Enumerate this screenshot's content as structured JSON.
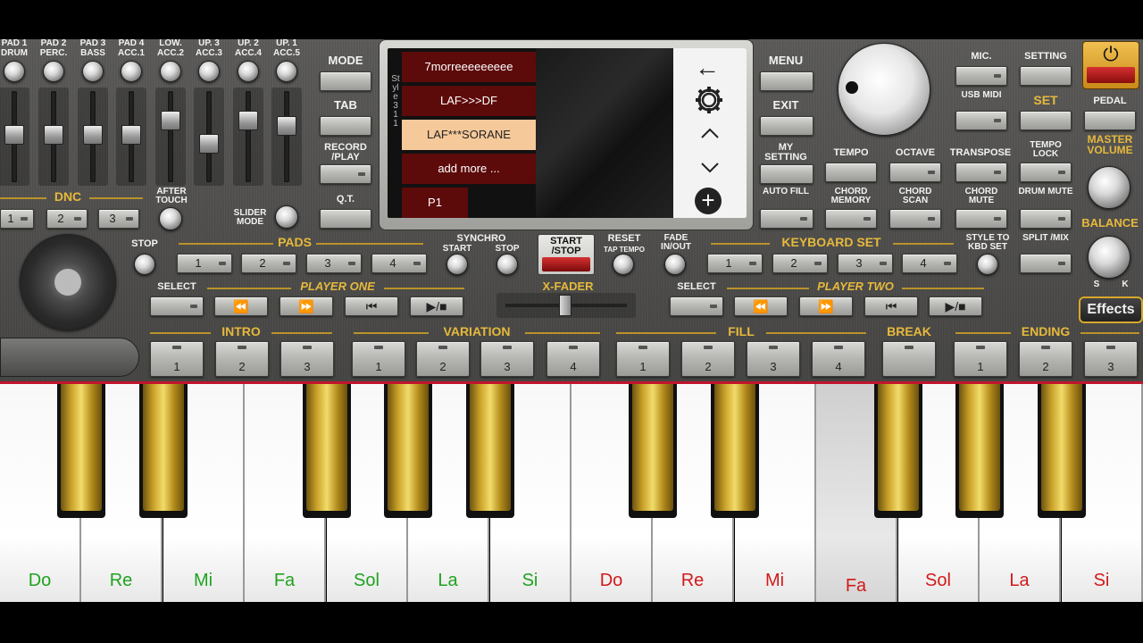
{
  "mixer": {
    "channels": [
      {
        "l1": "PAD 1",
        "l2": "DRUM"
      },
      {
        "l1": "PAD 2",
        "l2": "PERC."
      },
      {
        "l1": "PAD 3",
        "l2": "BASS"
      },
      {
        "l1": "PAD 4",
        "l2": "ACC.1"
      },
      {
        "l1": "LOW.",
        "l2": "ACC.2"
      },
      {
        "l1": "UP. 3",
        "l2": "ACC.3"
      },
      {
        "l1": "UP. 2",
        "l2": "ACC.4"
      },
      {
        "l1": "UP. 1",
        "l2": "ACC.5"
      }
    ],
    "dnc_label": "DNC",
    "dnc_buttons": [
      "1",
      "2",
      "3"
    ],
    "after_touch": "AFTER TOUCH",
    "slider_mode": "SLIDER MODE"
  },
  "left_buttons": {
    "mode": "MODE",
    "tab": "TAB",
    "record_play": "RECORD /PLAY",
    "qt": "Q.T."
  },
  "screen": {
    "side_label": "Style 3 1 1",
    "styles": [
      "7morreeeeeeeee",
      "LAF>>>DF",
      "LAF***SORANE",
      "add more ..."
    ],
    "selected_index": 2,
    "p1": "P1"
  },
  "right_menu": {
    "menu": "MENU",
    "exit": "EXIT",
    "my_setting": "MY SETTING",
    "auto_fill": "AUTO FILL"
  },
  "top_right": {
    "mic": "MIC.",
    "setting": "SETTING",
    "usb_midi": "USB MIDI",
    "set": "SET",
    "pedal": "PEDAL",
    "tempo": "TEMPO",
    "octave": "OCTAVE",
    "transpose": "TRANSPOSE",
    "tempo_lock": "TEMPO LOCK",
    "master_volume": "MASTER VOLUME",
    "chord_memory": "CHORD MEMORY",
    "chord_scan": "CHORD SCAN",
    "chord_mute": "CHORD MUTE",
    "drum_mute": "DRUM MUTE",
    "balance": "BALANCE",
    "balance_s": "S",
    "balance_k": "K",
    "effects": "Effects"
  },
  "pads": {
    "stop": "STOP",
    "label": "PADS",
    "buttons": [
      "1",
      "2",
      "3",
      "4"
    ],
    "synchro": "SYNCHRO",
    "sync_start": "START",
    "sync_stop": "STOP",
    "start_stop": "START /STOP",
    "reset": "RESET",
    "tap_tempo": "TAP TEMPO",
    "fade": "FADE IN/OUT"
  },
  "keyboard_set": {
    "label": "KEYBOARD SET",
    "buttons": [
      "1",
      "2",
      "3",
      "4"
    ],
    "style_to_kbd": "STYLE TO KBD SET",
    "split_mix": "SPLIT /MIX"
  },
  "players": {
    "select": "SELECT",
    "player_one": "PLAYER ONE",
    "x_fader": "X-FADER",
    "player_two": "PLAYER TWO",
    "transport": [
      "⏪",
      "⏩",
      "⏮",
      "▶/■"
    ]
  },
  "arranger": {
    "intro": "INTRO",
    "intro_buttons": [
      "1",
      "2",
      "3"
    ],
    "variation": "VARIATION",
    "variation_buttons": [
      "1",
      "2",
      "3",
      "4"
    ],
    "fill": "FILL",
    "fill_buttons": [
      "1",
      "2",
      "3",
      "4"
    ],
    "break": "BREAK",
    "ending": "ENDING",
    "ending_buttons": [
      "1",
      "2",
      "3"
    ]
  },
  "keys": {
    "notes": [
      "Do",
      "Re",
      "Mi",
      "Fa",
      "Sol",
      "La",
      "Si",
      "Do",
      "Re",
      "Mi",
      "Fa",
      "Sol",
      "La",
      "Si"
    ],
    "colors": {
      "low": "#1fa31f",
      "high": "#d21a1a"
    },
    "pressed_index": 10
  },
  "colors": {
    "accent": "#e6b93c",
    "selected_style": "#f6c99a",
    "style_bg": "#5d0a0a"
  }
}
